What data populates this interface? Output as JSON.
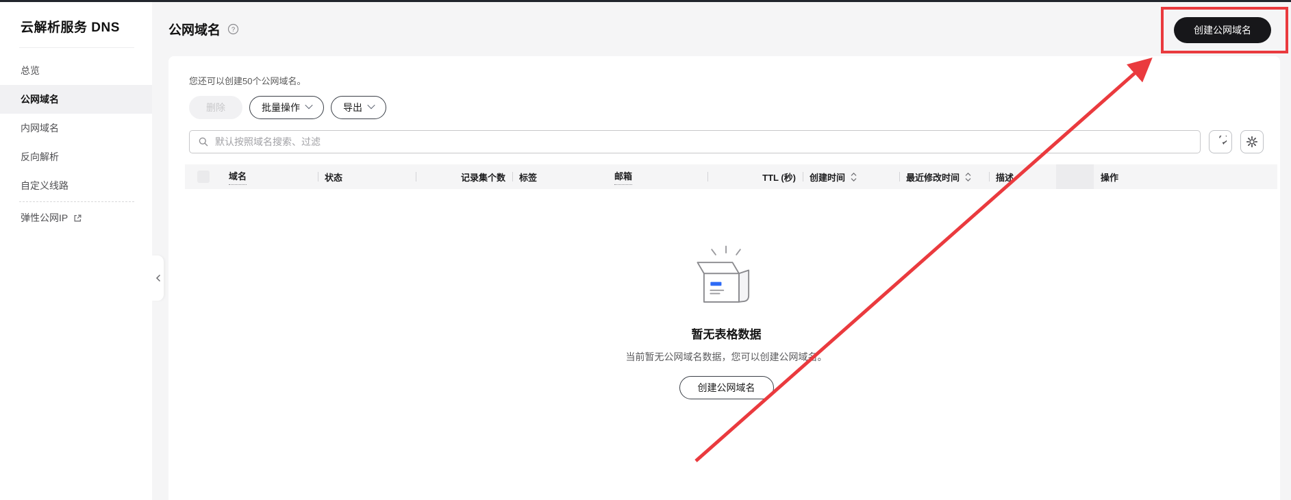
{
  "sidebar": {
    "title": "云解析服务 DNS",
    "items": [
      {
        "label": "总览",
        "active": false
      },
      {
        "label": "公网域名",
        "active": true
      },
      {
        "label": "内网域名",
        "active": false
      },
      {
        "label": "反向解析",
        "active": false
      },
      {
        "label": "自定义线路",
        "active": false
      },
      {
        "label": "弹性公网IP",
        "active": false,
        "external": true
      }
    ]
  },
  "header": {
    "title": "公网域名",
    "create_button_label": "创建公网域名"
  },
  "toolbar": {
    "quota_text": "您还可以创建50个公网域名。",
    "quota_remaining": 50,
    "delete_label": "删除",
    "batch_label": "批量操作",
    "export_label": "导出",
    "search_placeholder": "默认按照域名搜索、过滤"
  },
  "table": {
    "columns": [
      {
        "label": "域名",
        "dotted": true
      },
      {
        "label": "状态"
      },
      {
        "label": "记录集个数",
        "align": "right"
      },
      {
        "label": "标签"
      },
      {
        "label": "邮箱",
        "dotted": true
      },
      {
        "label": "TTL (秒)",
        "align": "right"
      },
      {
        "label": "创建时间",
        "sortable": true
      },
      {
        "label": "最近修改时间",
        "sortable": true
      },
      {
        "label": "描述"
      },
      {
        "label": "操作"
      }
    ],
    "rows": []
  },
  "empty_state": {
    "title": "暂无表格数据",
    "description": "当前暂无公网域名数据，您可以创建公网域名。",
    "button_label": "创建公网域名"
  },
  "icons": {
    "help": "question-circle-icon",
    "search": "magnifier-icon",
    "refresh": "refresh-icon",
    "settings": "gear-icon",
    "external_link": "external-link-icon",
    "collapse": "chevron-left-icon",
    "dropdown": "chevron-down-icon",
    "sort": "sort-arrows-icon",
    "empty": "empty-box-icon"
  },
  "colors": {
    "annotation_red": "#ea3a3e",
    "primary_button_bg": "#17171a",
    "empty_icon_blue": "#2e6bf6",
    "table_header_bg": "#f5f5f6"
  }
}
